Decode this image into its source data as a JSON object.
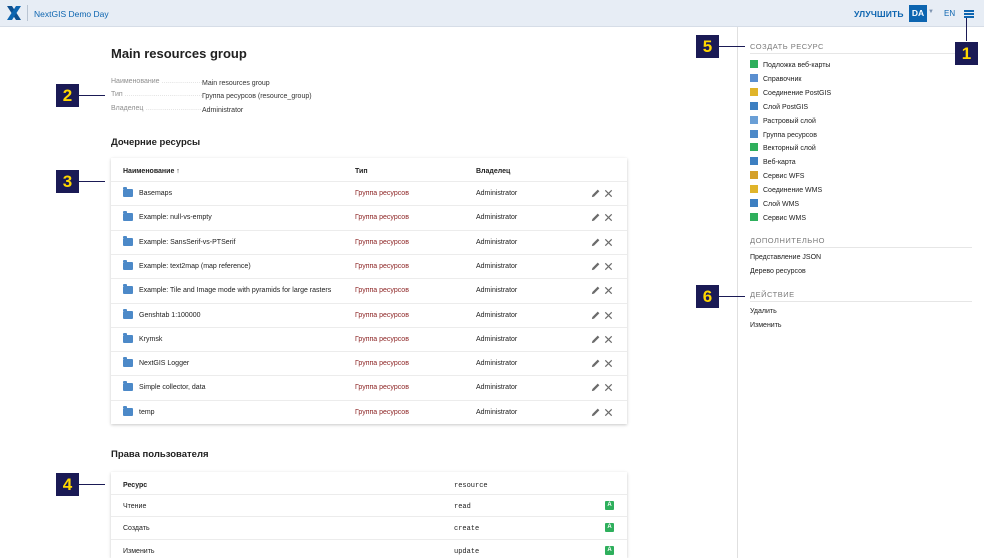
{
  "header": {
    "app_title": "NextGIS Demo Day",
    "upgrade": "УЛУЧШИТЬ",
    "user": "DA",
    "lang": "EN"
  },
  "main": {
    "title": "Main resources group",
    "meta": [
      {
        "key": "Наименование",
        "value": "Main resources group"
      },
      {
        "key": "Тип",
        "value": "Группа ресурсов (resource_group)"
      },
      {
        "key": "Владелец",
        "value": "Administrator"
      }
    ],
    "children_title": "Дочерние ресурсы",
    "children_headers": {
      "name": "Наименование ↑",
      "type": "Тип",
      "owner": "Владелец"
    },
    "children": [
      {
        "name": "Basemaps",
        "type": "Группа ресурсов",
        "owner": "Administrator"
      },
      {
        "name": "Example: null-vs-empty",
        "type": "Группа ресурсов",
        "owner": "Administrator"
      },
      {
        "name": "Example: SansSerif-vs-PTSerif",
        "type": "Группа ресурсов",
        "owner": "Administrator"
      },
      {
        "name": "Example: text2map (map reference)",
        "type": "Группа ресурсов",
        "owner": "Administrator"
      },
      {
        "name": "Example: Tile and Image mode with pyramids for large rasters",
        "type": "Группа ресурсов",
        "owner": "Administrator"
      },
      {
        "name": "Genshtab 1:100000",
        "type": "Группа ресурсов",
        "owner": "Administrator"
      },
      {
        "name": "Krymsk",
        "type": "Группа ресурсов",
        "owner": "Administrator"
      },
      {
        "name": "NextGIS Logger",
        "type": "Группа ресурсов",
        "owner": "Administrator"
      },
      {
        "name": "Simple collector, data",
        "type": "Группа ресурсов",
        "owner": "Administrator"
      },
      {
        "name": "temp",
        "type": "Группа ресурсов",
        "owner": "Administrator"
      }
    ],
    "perms_title": "Права пользователя",
    "perms_headers": {
      "resource": "Ресурс",
      "scope": "resource"
    },
    "perms": [
      {
        "label": "Чтение",
        "code": "read",
        "badge": "A"
      },
      {
        "label": "Создать",
        "code": "create",
        "badge": "A"
      },
      {
        "label": "Изменить",
        "code": "update",
        "badge": "A"
      }
    ]
  },
  "sidebar": {
    "create_title": "СОЗДАТЬ РЕСУРС",
    "create_items": [
      {
        "label": "Подложка веб-карты",
        "icon": "basemap-icon",
        "color": "#2eaf5c"
      },
      {
        "label": "Справочник",
        "icon": "lookup-table-icon",
        "color": "#5a8fd0"
      },
      {
        "label": "Соединение PostGIS",
        "icon": "postgis-connection-icon",
        "color": "#e0b42a"
      },
      {
        "label": "Слой PostGIS",
        "icon": "postgis-layer-icon",
        "color": "#3d7fc1"
      },
      {
        "label": "Растровый слой",
        "icon": "raster-layer-icon",
        "color": "#6a9fd6"
      },
      {
        "label": "Группа ресурсов",
        "icon": "resource-group-icon",
        "color": "#4c89c8"
      },
      {
        "label": "Векторный слой",
        "icon": "vector-layer-icon",
        "color": "#2eaf5c"
      },
      {
        "label": "Веб-карта",
        "icon": "webmap-icon",
        "color": "#3d7fc1"
      },
      {
        "label": "Сервис WFS",
        "icon": "wfs-service-icon",
        "color": "#d4a02a"
      },
      {
        "label": "Соединение WMS",
        "icon": "wms-connection-icon",
        "color": "#e0b42a"
      },
      {
        "label": "Слой WMS",
        "icon": "wms-layer-icon",
        "color": "#3d7fc1"
      },
      {
        "label": "Сервис WMS",
        "icon": "wms-service-icon",
        "color": "#2eaf5c"
      }
    ],
    "extra_title": "ДОПОЛНИТЕЛЬНО",
    "extra_items": [
      "Представление JSON",
      "Дерево ресурсов"
    ],
    "action_title": "ДЕЙСТВИЕ",
    "action_items": [
      "Удалить",
      "Изменить"
    ]
  },
  "callouts": [
    "1",
    "2",
    "3",
    "4",
    "5",
    "6"
  ]
}
